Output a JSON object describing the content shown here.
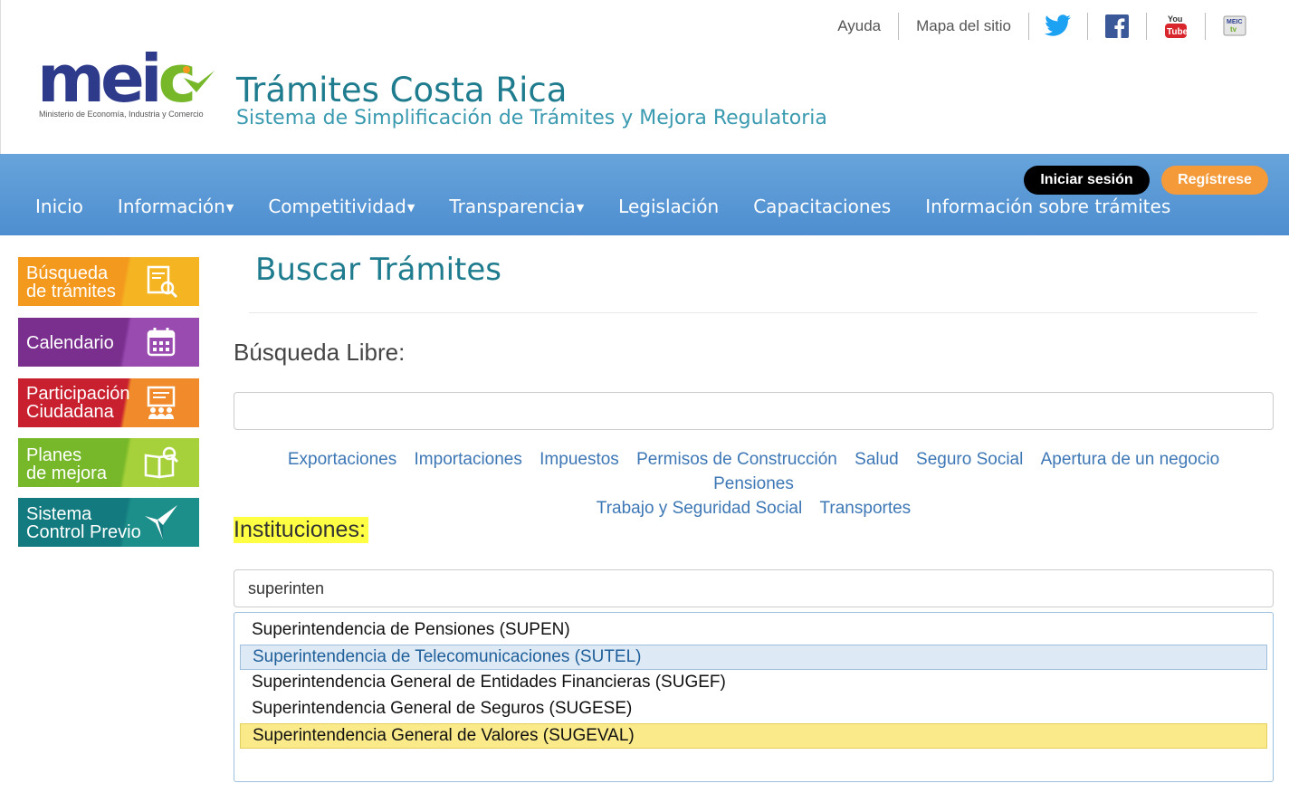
{
  "header": {
    "links": [
      "Ayuda",
      "Mapa del sitio"
    ],
    "social_icons": [
      "twitter-icon",
      "facebook-icon",
      "youtube-icon",
      "meic-tv-icon"
    ],
    "logo_text": "meic",
    "logo_caption": "Ministerio de Economía, Industria y Comercio",
    "title": "Trámites Costa Rica",
    "subtitle": "Sistema de Simplificación de Trámites y Mejora Regulatoria"
  },
  "nav": {
    "login_label": "Iniciar sesión",
    "register_label": "Regístrese",
    "items": [
      "Inicio",
      "Información",
      "Competitividad",
      "Transparencia",
      "Legislación",
      "Capacitaciones",
      "Información sobre trámites"
    ]
  },
  "sidebar": {
    "items": [
      {
        "label": "Búsqueda\nde trámites",
        "color": "#f39a1e"
      },
      {
        "label": "Calendario",
        "color": "#7a2f8f"
      },
      {
        "label": "Participación\nCiudadana",
        "color": "#c8202f"
      },
      {
        "label": "Planes\nde mejora",
        "color": "#76b82a"
      },
      {
        "label": "Sistema\nControl Previo",
        "color": "#137a7f"
      }
    ]
  },
  "main": {
    "title": "Buscar Trámites",
    "libre_label": "Búsqueda Libre:",
    "libre_value": "",
    "tags": [
      "Exportaciones",
      "Importaciones",
      "Impuestos",
      "Permisos de Construcción",
      "Salud",
      "Seguro Social",
      "Apertura de un negocio",
      "Pensiones",
      "Trabajo y Seguridad Social",
      "Transportes"
    ],
    "inst_label": "Instituciones:",
    "inst_value": "superinten",
    "options": [
      "Superintendencia de Pensiones (SUPEN)",
      "Superintendencia de Telecomunicaciones (SUTEL)",
      "Superintendencia General de Entidades Financieras (SUGEF)",
      "Superintendencia General de Seguros (SUGESE)",
      "Superintendencia General de Valores (SUGEVAL)"
    ]
  }
}
